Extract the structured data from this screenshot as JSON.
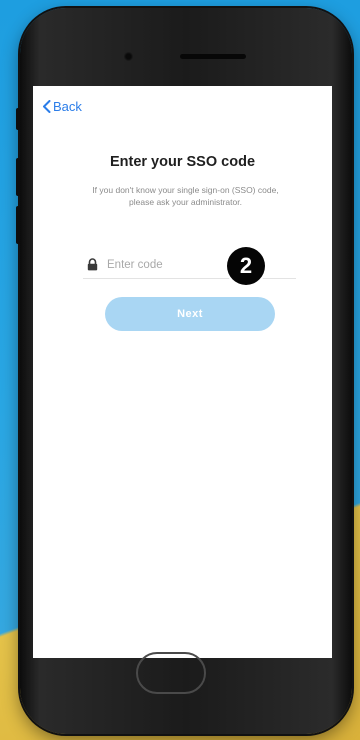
{
  "colors": {
    "accent": "#2b7de9",
    "button_disabled": "#a9d6f3",
    "badge": "#050505"
  },
  "nav": {
    "back_label": "Back",
    "back_icon": "chevron-left-icon"
  },
  "sso": {
    "title": "Enter your SSO code",
    "description": "If you don't know your single sign-on (SSO) code, please ask your administrator.",
    "field": {
      "placeholder": "Enter code",
      "value": "",
      "icon": "lock-icon"
    },
    "next_label": "Next"
  },
  "annotation": {
    "step_number": "2"
  }
}
